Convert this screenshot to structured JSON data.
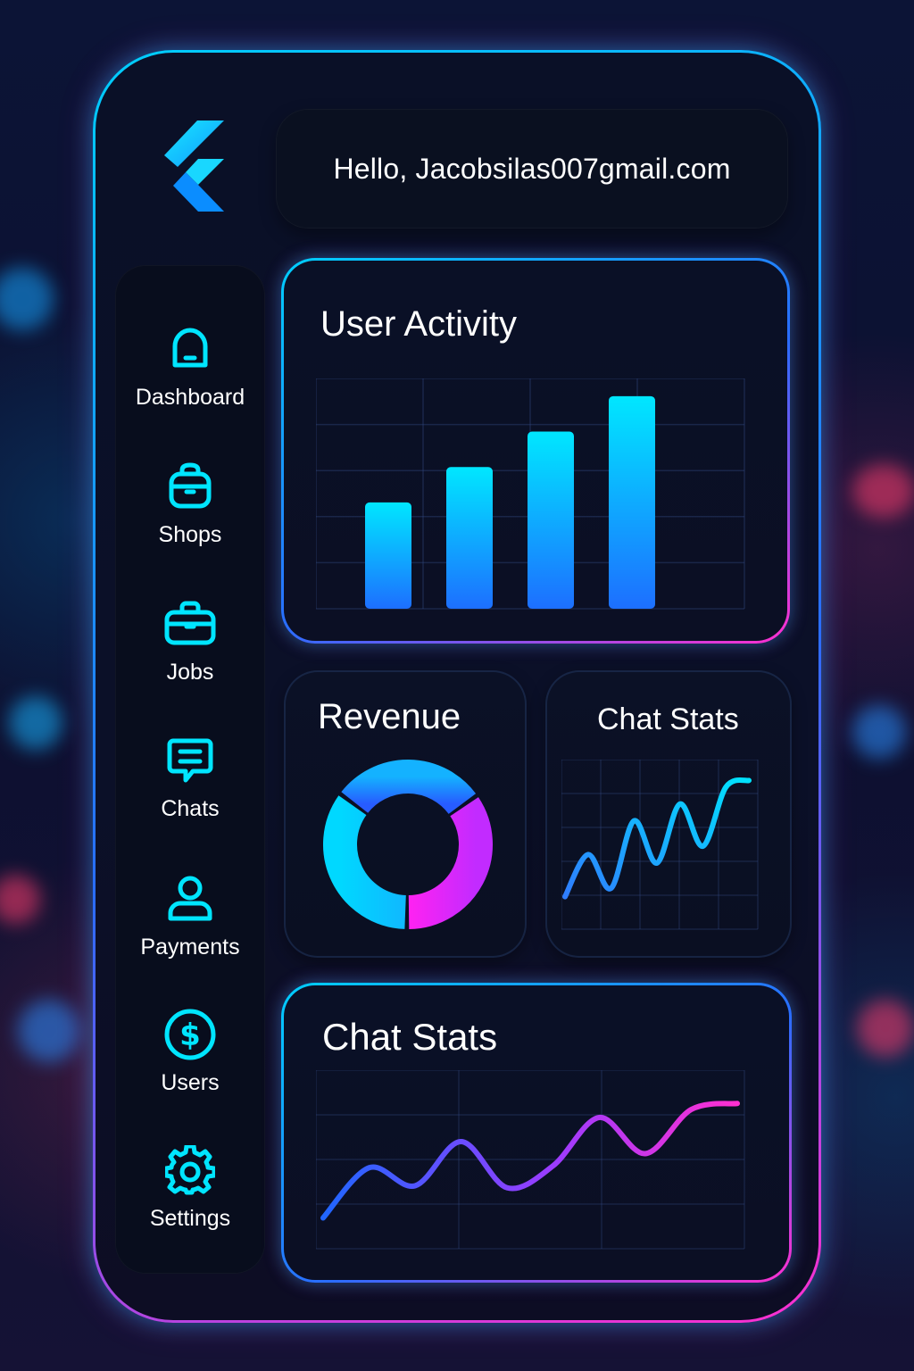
{
  "greeting": {
    "text": "Hello, Jacobsilas007gmail.com"
  },
  "logo": {
    "icon": "flutter-logo-icon"
  },
  "sidebar": {
    "items": [
      {
        "label": "Dashboard",
        "icon": "bell-icon"
      },
      {
        "label": "Shops",
        "icon": "shopping-bag-icon"
      },
      {
        "label": "Jobs",
        "icon": "briefcase-icon"
      },
      {
        "label": "Chats",
        "icon": "chat-icon"
      },
      {
        "label": "Payments",
        "icon": "user-icon"
      },
      {
        "label": "Users",
        "icon": "dollar-circle-icon"
      },
      {
        "label": "Settings",
        "icon": "gear-icon"
      }
    ]
  },
  "cards": {
    "user_activity": {
      "title": "User Activity"
    },
    "revenue": {
      "title": "Revenue"
    },
    "chat_stats_small": {
      "title": "Chat Stats"
    },
    "chat_stats_large": {
      "title": "Chat Stats"
    }
  },
  "colors": {
    "accent_cyan": "#00d8ff",
    "accent_blue": "#2a6dff",
    "accent_magenta": "#ff2fd0",
    "card_bg": "#0b1024"
  },
  "chart_data": [
    {
      "type": "bar",
      "categories": [
        "",
        "",
        "",
        ""
      ],
      "values": [
        3.0,
        4.0,
        5.0,
        6.0
      ],
      "ylim": [
        0,
        6.5
      ],
      "grid": true
    },
    {
      "type": "pie",
      "labels": [
        "",
        "",
        ""
      ],
      "values": [
        35,
        30,
        35
      ],
      "donut": true
    },
    {
      "type": "line",
      "x": [
        0,
        1,
        2,
        3,
        4,
        5,
        6,
        7,
        8
      ],
      "values": [
        1.5,
        4.0,
        2.0,
        6.0,
        3.5,
        7.0,
        4.5,
        8.0,
        8.4
      ],
      "grid": true
    },
    {
      "type": "line",
      "x": [
        0,
        1,
        2,
        3,
        4,
        5,
        6,
        7,
        8,
        9
      ],
      "values": [
        1.0,
        3.5,
        2.6,
        4.8,
        2.5,
        3.6,
        6.0,
        4.2,
        6.4,
        6.7
      ],
      "grid": true
    }
  ]
}
